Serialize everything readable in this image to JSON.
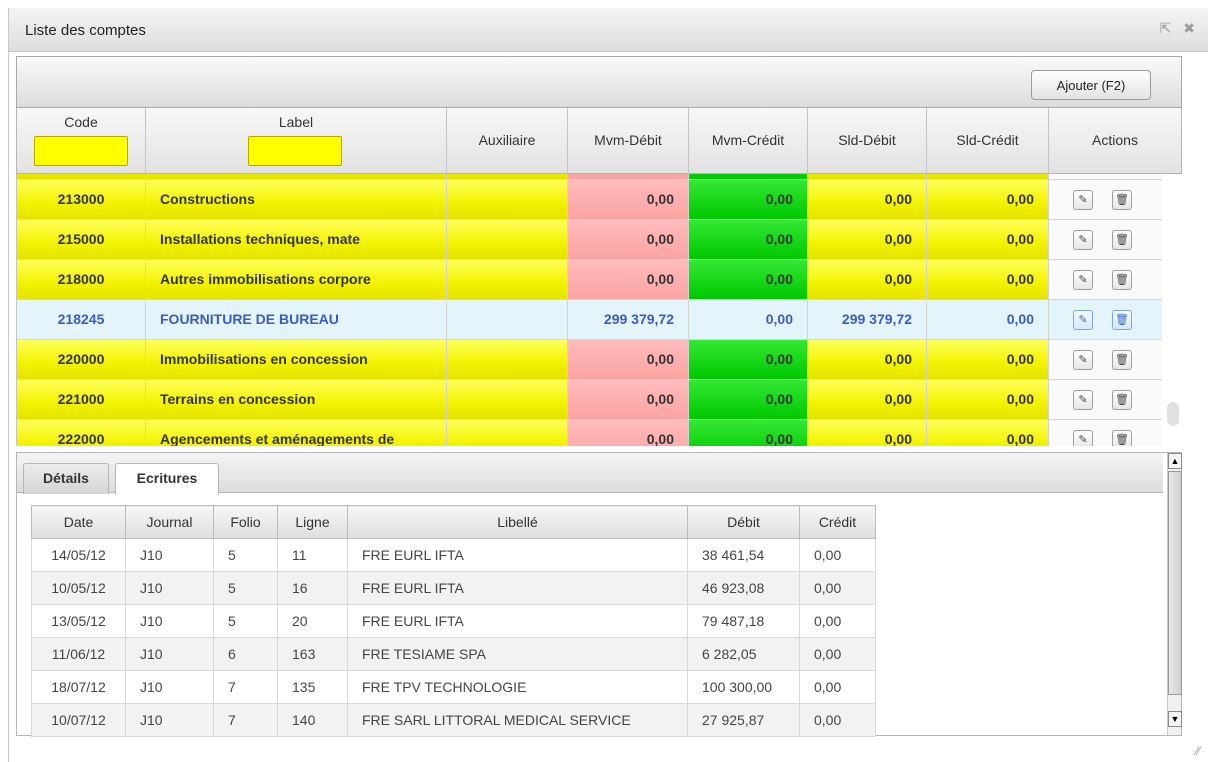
{
  "window": {
    "title": "Liste des comptes",
    "popout_glyph": "⇱",
    "close_glyph": "✖"
  },
  "toolbar": {
    "add_label": "Ajouter (F2)"
  },
  "columns": {
    "code": "Code",
    "label": "Label",
    "auxiliaire": "Auxiliaire",
    "mvm_debit": "Mvm-Débit",
    "mvm_credit": "Mvm-Crédit",
    "sld_debit": "Sld-Débit",
    "sld_credit": "Sld-Crédit",
    "actions": "Actions"
  },
  "filters": {
    "code_value": "",
    "label_value": ""
  },
  "accounts": [
    {
      "code": "213000",
      "label": "Constructions",
      "aux": "",
      "mvm_debit": "0,00",
      "mvm_credit": "0,00",
      "sld_debit": "0,00",
      "sld_credit": "0,00"
    },
    {
      "code": "215000",
      "label": "Installations techniques, mate",
      "aux": "",
      "mvm_debit": "0,00",
      "mvm_credit": "0,00",
      "sld_debit": "0,00",
      "sld_credit": "0,00"
    },
    {
      "code": "218000",
      "label": "Autres immobilisations corpore",
      "aux": "",
      "mvm_debit": "0,00",
      "mvm_credit": "0,00",
      "sld_debit": "0,00",
      "sld_credit": "0,00"
    },
    {
      "code": "218245",
      "label": "FOURNITURE DE BUREAU",
      "aux": "",
      "mvm_debit": "299 379,72",
      "mvm_credit": "0,00",
      "sld_debit": "299 379,72",
      "sld_credit": "0,00",
      "selected": true
    },
    {
      "code": "220000",
      "label": "Immobilisations en concession",
      "aux": "",
      "mvm_debit": "0,00",
      "mvm_credit": "0,00",
      "sld_debit": "0,00",
      "sld_credit": "0,00"
    },
    {
      "code": "221000",
      "label": "Terrains en concession",
      "aux": "",
      "mvm_debit": "0,00",
      "mvm_credit": "0,00",
      "sld_debit": "0,00",
      "sld_credit": "0,00"
    },
    {
      "code": "222000",
      "label": "Agencements et aménagements de",
      "aux": "",
      "mvm_debit": "0,00",
      "mvm_credit": "0,00",
      "sld_debit": "0,00",
      "sld_credit": "0,00"
    }
  ],
  "action_icons": {
    "edit": "✎",
    "delete": "🗑"
  },
  "tabs": {
    "details": "Détails",
    "ecritures": "Ecritures"
  },
  "ecritures": {
    "headers": [
      "Date",
      "Journal",
      "Folio",
      "Ligne",
      "Libellé",
      "Débit",
      "Crédit"
    ],
    "rows": [
      [
        "14/05/12",
        "J10",
        "5",
        "11",
        "FRE EURL IFTA",
        "38 461,54",
        "0,00"
      ],
      [
        "10/05/12",
        "J10",
        "5",
        "16",
        "FRE EURL IFTA",
        "46 923,08",
        "0,00"
      ],
      [
        "13/05/12",
        "J10",
        "5",
        "20",
        "FRE EURL IFTA",
        "79 487,18",
        "0,00"
      ],
      [
        "11/06/12",
        "J10",
        "6",
        "163",
        "FRE TESIAME SPA",
        "6 282,05",
        "0,00"
      ],
      [
        "18/07/12",
        "J10",
        "7",
        "135",
        "FRE TPV TECHNOLOGIE",
        "100 300,00",
        "0,00"
      ],
      [
        "10/07/12",
        "J10",
        "7",
        "140",
        "FRE SARL LITTORAL MEDICAL SERVICE",
        "27 925,87",
        "0,00"
      ]
    ]
  },
  "scroll_arrows": {
    "up": "▲",
    "down": "▼"
  },
  "resize_grip": "⁄⁄"
}
